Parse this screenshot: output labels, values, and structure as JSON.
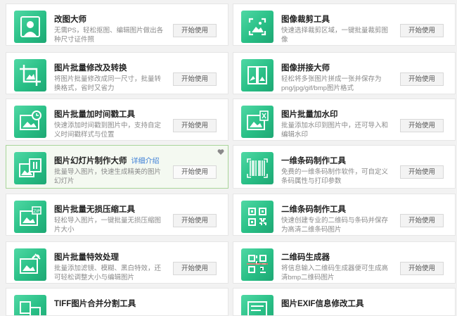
{
  "accent": "#2ec08a",
  "tools": [
    {
      "title": "改图大师",
      "link": "",
      "desc": "无需PS，轻松抠图、编辑图片做出各种尺寸证件照",
      "button": "开始使用",
      "icon": "portrait-icon",
      "highlighted": false
    },
    {
      "title": "图像裁剪工具",
      "link": "",
      "desc": "快速选择裁剪区域，一键批量裁剪图像",
      "button": "开始使用",
      "icon": "crop-frame-icon",
      "highlighted": false
    },
    {
      "title": "图片批量修改及转换",
      "link": "",
      "desc": "将图片批量修改成同一尺寸，批量转换格式，省时又省力",
      "button": "开始使用",
      "icon": "crop-icon",
      "highlighted": false
    },
    {
      "title": "图像拼接大师",
      "link": "",
      "desc": "轻松将多张图片拼成一张并保存为png/jpg/gif/bmp图片格式",
      "button": "开始使用",
      "icon": "stitch-icon",
      "highlighted": false
    },
    {
      "title": "图片批量加时间戳工具",
      "link": "",
      "desc": "快速添加时间戳到图片中，支持自定义时间戳样式与位置",
      "button": "开始使用",
      "icon": "timestamp-icon",
      "highlighted": false
    },
    {
      "title": "图片批量加水印",
      "link": "",
      "desc": "批量添加水印到图片中，还可导入和编辑水印",
      "button": "开始使用",
      "icon": "watermark-icon",
      "highlighted": false
    },
    {
      "title": "图片幻灯片制作大师",
      "link": "详细介绍",
      "desc": "批量导入图片，快速生成精美的图片幻灯片",
      "button": "开始使用",
      "icon": "slideshow-icon",
      "highlighted": true
    },
    {
      "title": "一维条码制作工具",
      "link": "",
      "desc": "免费的一维条码制作软件，可自定义条码属性与打印参数",
      "button": "开始使用",
      "icon": "barcode-icon",
      "highlighted": false
    },
    {
      "title": "图片批量无损压缩工具",
      "link": "",
      "desc": "轻松导入图片，一键批量无损压缩图片大小",
      "button": "开始使用",
      "icon": "compress-icon",
      "highlighted": false
    },
    {
      "title": "二维条码制作工具",
      "link": "",
      "desc": "快速创建专业的二维码与条码并保存为高清二维条码图片",
      "button": "开始使用",
      "icon": "qrcode-icon",
      "highlighted": false
    },
    {
      "title": "图片批量特效处理",
      "link": "",
      "desc": "批量添加滤镜、模糊、黑白特效，还可轻松调整大小与编辑图片",
      "button": "开始使用",
      "icon": "effects-icon",
      "highlighted": false
    },
    {
      "title": "二维码生成器",
      "link": "",
      "desc": "将信息输入二维码生成器便可生成高清bmp二维码图片",
      "button": "开始使用",
      "icon": "qr-generator-icon",
      "highlighted": false
    },
    {
      "title": "TIFF图片合并分割工具",
      "link": "",
      "desc": "",
      "button": "",
      "icon": "tiff-icon",
      "highlighted": false
    },
    {
      "title": "图片EXIF信息修改工具",
      "link": "",
      "desc": "",
      "button": "",
      "icon": "exif-icon",
      "highlighted": false
    }
  ]
}
